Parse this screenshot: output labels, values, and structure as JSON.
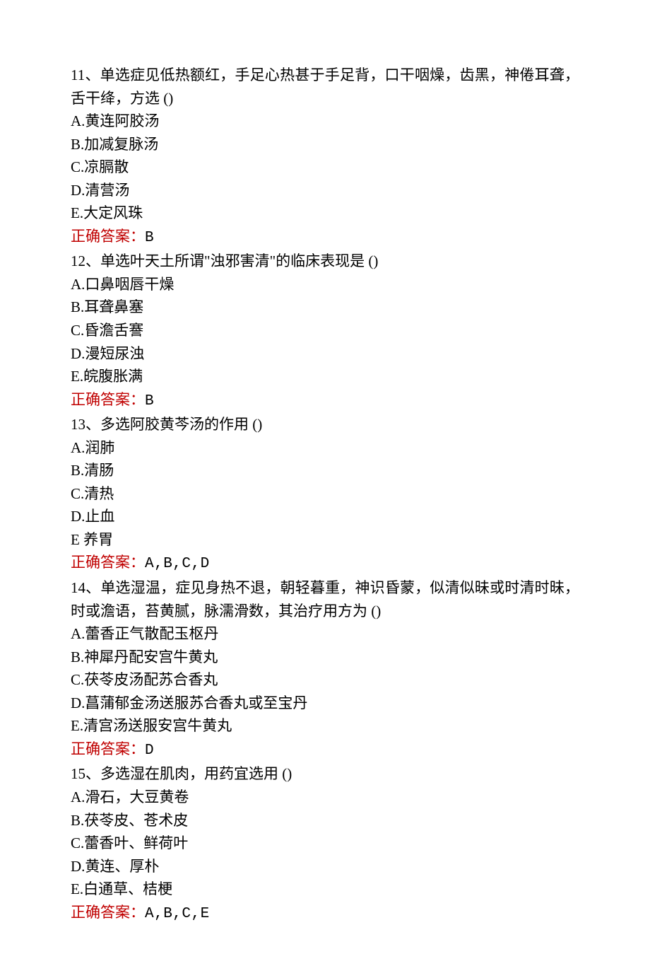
{
  "questions": [
    {
      "number": "11",
      "type": "单选",
      "stem": "症见低热额红，手足心热甚于手足背，口干咽燥，齿黑，神倦耳聋，舌干绛，方选 ()",
      "options": [
        "A.黄连阿胶汤",
        "B.加减复脉汤",
        "C.凉膈散",
        "D.清营汤",
        "E.大定风珠"
      ],
      "correct": "B"
    },
    {
      "number": "12",
      "type": "单选",
      "stem": "叶天土所谓\"浊邪害清\"的临床表现是 ()",
      "options": [
        "A.口鼻咽唇干燥",
        "B.耳聋鼻塞",
        "C.昏澹舌謇",
        "D.漫短尿浊",
        "E.皖腹胀满"
      ],
      "correct": "B"
    },
    {
      "number": "13",
      "type": "多选",
      "stem": "阿胶黄芩汤的作用 ()",
      "options": [
        "A.润肺",
        "B.清肠",
        "C.清热",
        "D.止血",
        "E 养胃"
      ],
      "correct": "A,B,C,D"
    },
    {
      "number": "14",
      "type": "单选",
      "stem": "湿温，症见身热不退，朝轻暮重，神识昏蒙，似清似昧或时清时昧，时或澹语，苔黄腻，脉濡滑数，其治疗用方为 ()",
      "options": [
        "A.蕾香正气散配玉枢丹",
        "B.神犀丹配安宫牛黄丸",
        "C.茯苓皮汤配苏合香丸",
        "D.菖蒲郁金汤送服苏合香丸或至宝丹",
        "E.清宫汤送服安宫牛黄丸"
      ],
      "correct": "D"
    },
    {
      "number": "15",
      "type": "多选",
      "stem": "湿在肌肉，用药宜选用 ()",
      "options": [
        "A.滑石，大豆黄卷",
        "B.茯苓皮、苍术皮",
        "C.蕾香叶、鲜荷叶",
        "D.黄连、厚朴",
        "E.白通草、桔梗"
      ],
      "correct": "A,B,C,E"
    }
  ],
  "labels": {
    "answer_prefix": "正确答案："
  }
}
